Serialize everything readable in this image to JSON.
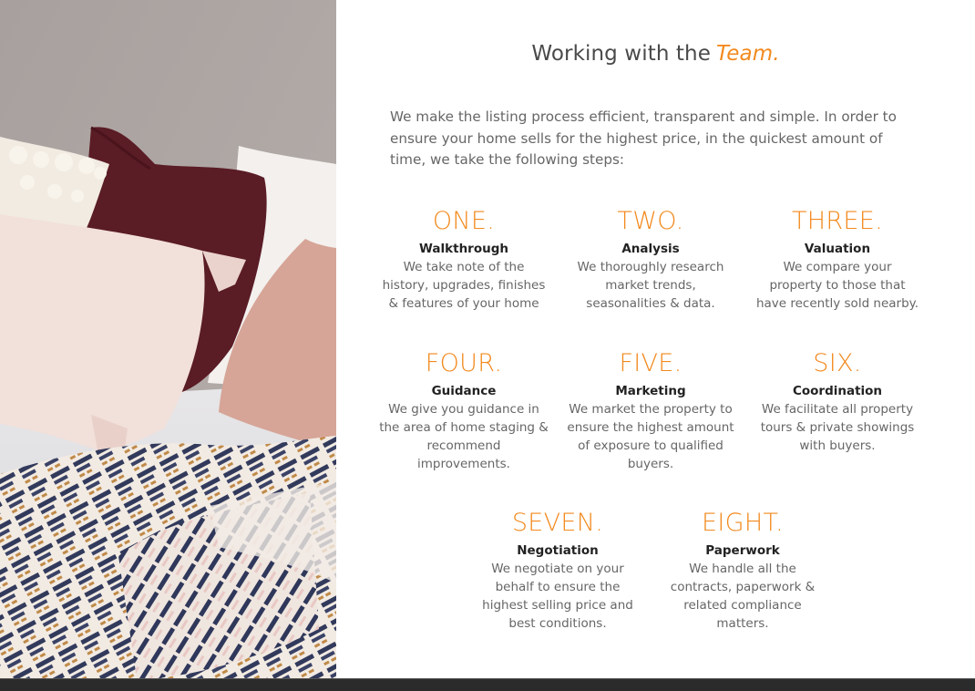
{
  "title": {
    "main": "Working with the",
    "accent": "Team."
  },
  "intro": "We make the listing process efficient, transparent and simple. In order to ensure your home sells for the highest price, in the quickest amount of time, we take the following steps:",
  "steps": [
    {
      "number": "ONE.",
      "name": "Walkthrough",
      "lines": [
        "We take note of the",
        "history, upgrades, finishes",
        "& features of your home"
      ]
    },
    {
      "number": "TWO.",
      "name": "Analysis",
      "lines": [
        "We thoroughly research",
        "market trends,",
        "seasonalities & data."
      ]
    },
    {
      "number": "THREE.",
      "name": "Valuation",
      "lines": [
        "We compare your",
        "property to those that",
        "have recently sold nearby."
      ]
    },
    {
      "number": "FOUR.",
      "name": "Guidance",
      "lines": [
        "We give you guidance in",
        "the area of home staging &",
        "recommend",
        "improvements."
      ]
    },
    {
      "number": "FIVE.",
      "name": "Marketing",
      "lines": [
        "We market the property to",
        "ensure the highest amount",
        "of exposure to qualified",
        "buyers."
      ]
    },
    {
      "number": "SIX.",
      "name": "Coordination",
      "lines": [
        "We facilitate all property",
        "tours & private showings",
        "with buyers."
      ]
    },
    {
      "number": "SEVEN.",
      "name": "Negotiation",
      "lines": [
        "We negotiate on your",
        "behalf to ensure the",
        "highest selling price and",
        "best conditions."
      ]
    },
    {
      "number": "EIGHT.",
      "name": "Paperwork",
      "lines": [
        "We handle all the",
        "contracts, paperwork &",
        "related compliance",
        "matters."
      ]
    }
  ],
  "photo": {
    "subject": "pillows-and-throw-blanket-photo"
  },
  "colors": {
    "accent": "#f28a1f",
    "heading_text": "#4a4a4a",
    "body_text": "#666666",
    "bottom_bar": "#2b2b2b"
  }
}
